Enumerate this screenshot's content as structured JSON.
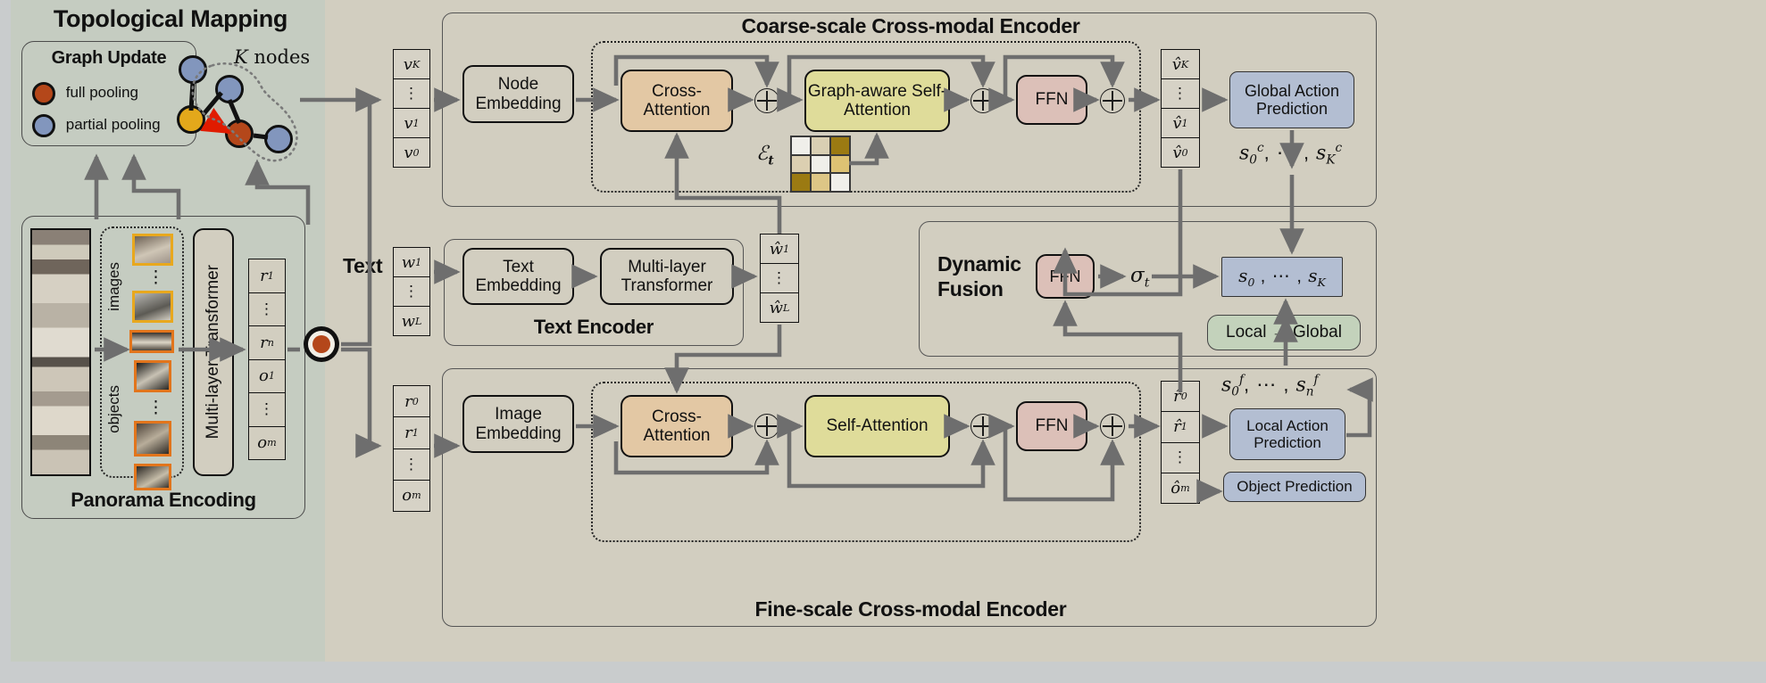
{
  "figure": {
    "kind": "neural-network-architecture-diagram",
    "panels": {
      "topological_mapping": {
        "title": "Topological Mapping",
        "graph_update": {
          "title": "Graph Update",
          "legend": [
            {
              "label": "full pooling",
              "color": "#b4471a"
            },
            {
              "label": "partial pooling",
              "color": "#8296bd"
            }
          ]
        },
        "k_nodes_label": "K nodes"
      },
      "panorama_encoding": {
        "title": "Panorama Encoding",
        "images_label": "images",
        "objects_label": "objects",
        "transformer_label": "Multi-layer Transformer",
        "tokens": [
          "r1",
          "⋮",
          "rn",
          "o1",
          "⋮",
          "om"
        ]
      },
      "coarse_encoder": {
        "title": "Coarse-scale Cross-modal Encoder",
        "input_tokens": [
          "vK",
          "⋮",
          "v1",
          "v0"
        ],
        "node_embedding": "Node Embedding",
        "cross_attention": "Cross-Attention",
        "graph_self_attention": "Graph-aware Self-Attention",
        "ffn": "FFN",
        "edge_matrix_label": "Et",
        "output_tokens": [
          "v̂K",
          "⋮",
          "v̂1",
          "v̂0"
        ],
        "global_action_prediction": "Global Action Prediction",
        "coarse_scores": "s0c, ⋯, sKc"
      },
      "text_encoder": {
        "title": "Text Encoder",
        "text_label": "Text",
        "input_tokens": [
          "w1",
          "⋮",
          "wL"
        ],
        "text_embedding": "Text Embedding",
        "multilayer_transformer": "Multi-layer Transformer",
        "output_tokens": [
          "ŵ1",
          "⋮",
          "ŵL"
        ]
      },
      "fine_encoder": {
        "title": "Fine-scale Cross-modal Encoder",
        "input_tokens": [
          "r0",
          "r1",
          "⋮",
          "om"
        ],
        "image_embedding": "Image Embedding",
        "cross_attention": "Cross-Attention",
        "self_attention": "Self-Attention",
        "ffn": "FFN",
        "output_tokens": [
          "r̂0",
          "r̂1",
          "⋮",
          "ôm"
        ],
        "local_action_prediction": "Local Action Prediction",
        "object_prediction": "Object Prediction",
        "fine_scores": "s0f, ⋯, snf"
      },
      "dynamic_fusion": {
        "title": "Dynamic Fusion",
        "ffn": "FFN",
        "sigma": "σt",
        "fused_scores": "s0 , ⋯, sK",
        "local_to_global": "Local → Global"
      }
    },
    "colors": {
      "left_panel_bg": "#c5ccc1",
      "right_panel_bg": "#d2cec0",
      "page_bg": "#c9cccd",
      "cross_attention": "#e3c8a4",
      "self_attention": "#dfdc9a",
      "ffn": "#dcc0b8",
      "prediction": "#b3bed2",
      "local_to_global": "#c3d2bb",
      "arrow": "#6e6e6e",
      "full_pooling_node": "#b4471a",
      "partial_pooling_node": "#8296bd",
      "current_node": "#e3a81b",
      "red_arrow": "#e01b00",
      "image_thumb_border": "#e8a81e",
      "object_thumb_border": "#e2751c"
    }
  }
}
